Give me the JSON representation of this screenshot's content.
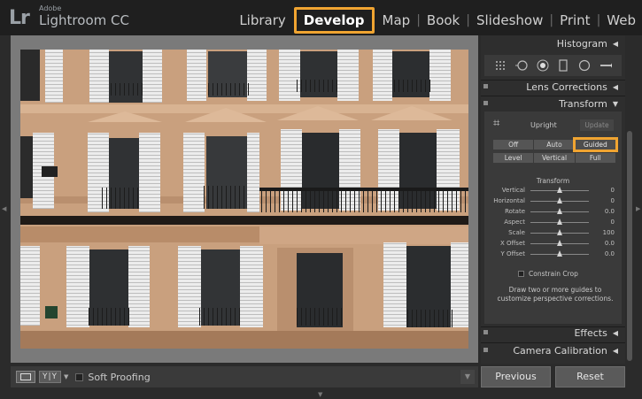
{
  "app": {
    "brand_small": "Adobe",
    "brand_main": "Lightroom CC",
    "logo": "Lr"
  },
  "modules": [
    {
      "label": "Library",
      "active": false
    },
    {
      "label": "Develop",
      "active": true
    },
    {
      "label": "Map",
      "active": false
    },
    {
      "label": "Book",
      "active": false
    },
    {
      "label": "Slideshow",
      "active": false
    },
    {
      "label": "Print",
      "active": false
    },
    {
      "label": "Web",
      "active": false
    }
  ],
  "panels": {
    "histogram": "Histogram",
    "lens": "Lens Corrections",
    "transform": "Transform",
    "effects": "Effects",
    "camera": "Camera Calibration"
  },
  "transform": {
    "upright_label": "Upright",
    "update_label": "Update",
    "modes_row1": [
      "Off",
      "Auto",
      "Guided"
    ],
    "modes_row2": [
      "Level",
      "Vertical",
      "Full"
    ],
    "selected_mode": "Guided",
    "section_title": "Transform",
    "sliders": [
      {
        "label": "Vertical",
        "value": "0",
        "position": 0.5
      },
      {
        "label": "Horizontal",
        "value": "0",
        "position": 0.5
      },
      {
        "label": "Rotate",
        "value": "0.0",
        "position": 0.5
      },
      {
        "label": "Aspect",
        "value": "0",
        "position": 0.5
      },
      {
        "label": "Scale",
        "value": "100",
        "position": 0.5
      },
      {
        "label": "X Offset",
        "value": "0.0",
        "position": 0.5
      },
      {
        "label": "Y Offset",
        "value": "0.0",
        "position": 0.5
      }
    ],
    "constrain_crop": "Constrain Crop",
    "hint": "Draw two or more guides to customize perspective corrections."
  },
  "toolbar": {
    "yy": "Y|Y",
    "soft_proofing": "Soft Proofing"
  },
  "buttons": {
    "previous": "Previous",
    "reset": "Reset"
  },
  "colors": {
    "highlight": "#f0a431",
    "facade": "#c9a07e",
    "shutter": "#ececec"
  }
}
